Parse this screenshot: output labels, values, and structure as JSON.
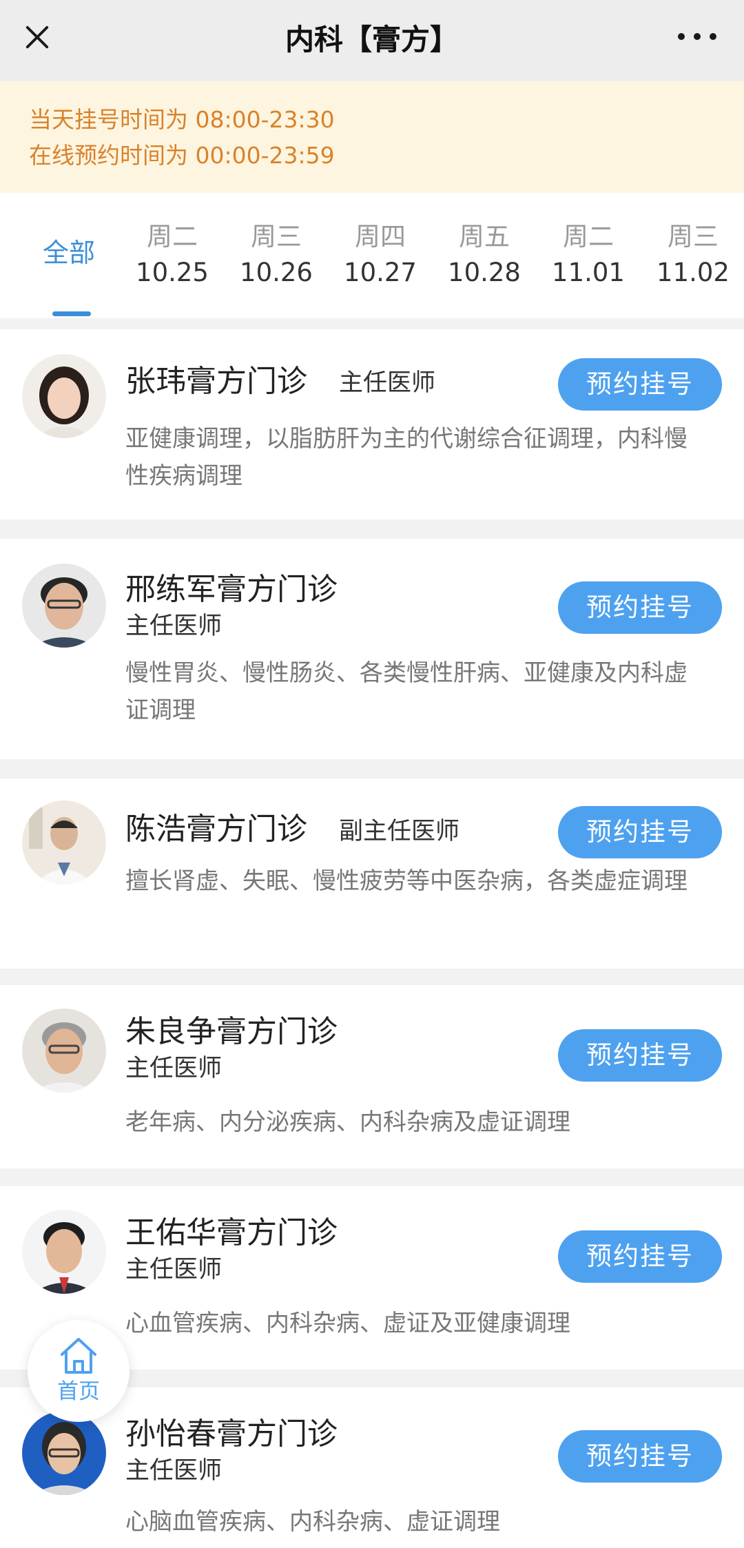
{
  "header": {
    "title": "内科【膏方】",
    "close_icon": "close-icon",
    "more_icon": "more-icon"
  },
  "notice": {
    "line1": "当天挂号时间为 08:00-23:30",
    "line2": "在线预约时间为 00:00-23:59",
    "color": "#d9822b"
  },
  "date_tabs": {
    "all_label": "全部",
    "days": [
      {
        "weekday": "周二",
        "date": "10.25"
      },
      {
        "weekday": "周三",
        "date": "10.26"
      },
      {
        "weekday": "周四",
        "date": "10.27"
      },
      {
        "weekday": "周五",
        "date": "10.28"
      },
      {
        "weekday": "周二",
        "date": "11.01"
      },
      {
        "weekday": "周三",
        "date": "11.02"
      }
    ]
  },
  "book_label": "预约挂号",
  "accent_color": "#4ea1ef",
  "doctors": [
    {
      "name": "张玮膏方门诊",
      "title": "主任医师",
      "desc": "亚健康调理，以脂肪肝为主的代谢综合征调理，内科慢性疾病调理"
    },
    {
      "name": "邢练军膏方门诊",
      "title": "主任医师",
      "desc": "慢性胃炎、慢性肠炎、各类慢性肝病、亚健康及内科虚证调理"
    },
    {
      "name": "陈浩膏方门诊",
      "title": "副主任医师",
      "desc": "擅长肾虚、失眠、慢性疲劳等中医杂病，各类虚症调理"
    },
    {
      "name": "朱良争膏方门诊",
      "title": "主任医师",
      "desc": "老年病、内分泌疾病、内科杂病及虚证调理"
    },
    {
      "name": "王佑华膏方门诊",
      "title": "主任医师",
      "desc": "心血管疾病、内科杂病、虚证及亚健康调理"
    },
    {
      "name": "孙怡春膏方门诊",
      "title": "主任医师",
      "desc": "心脑血管疾病、内科杂病、虚证调理"
    }
  ],
  "home_fab": {
    "label": "首页",
    "icon": "home-icon"
  }
}
